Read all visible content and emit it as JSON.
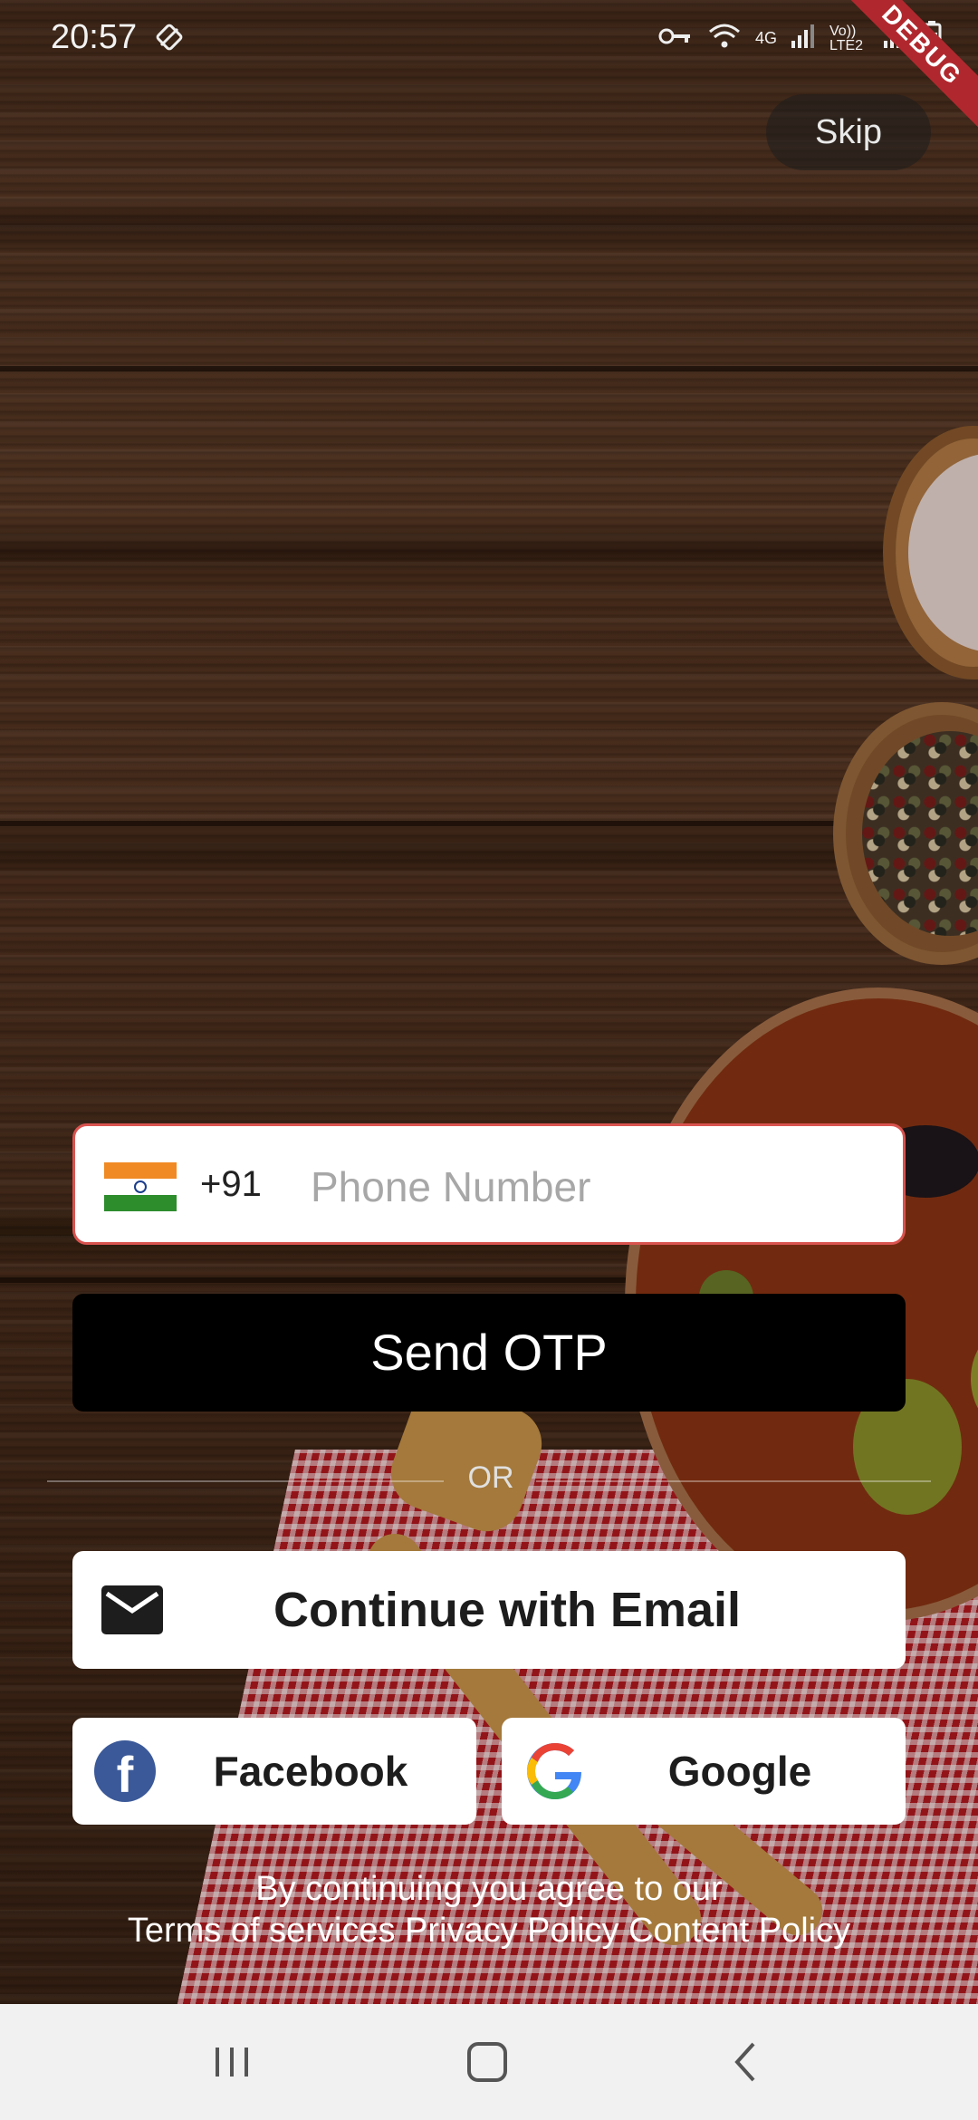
{
  "status_bar": {
    "time": "20:57",
    "network_4g": "4G",
    "network_lte": "Vo)) LTE2",
    "debug_banner": "DEBUG"
  },
  "skip": {
    "label": "Skip"
  },
  "phone_field": {
    "country_code": "+91",
    "placeholder": "Phone Number",
    "value": "",
    "flag": "india-flag-icon"
  },
  "send_otp": {
    "label": "Send OTP"
  },
  "divider": {
    "label": "OR"
  },
  "email_button": {
    "label": "Continue with Email",
    "icon": "envelope-icon"
  },
  "facebook_button": {
    "label": "Facebook",
    "icon": "facebook-icon"
  },
  "google_button": {
    "label": "Google",
    "icon": "google-icon"
  },
  "terms": {
    "line1": "By continuing you agree to our",
    "terms_link": "Terms of services",
    "privacy_link": "Privacy Policy",
    "content_link": "Content Policy"
  },
  "nav": {
    "recents": "recents-icon",
    "home": "home-icon",
    "back": "back-icon"
  },
  "colors": {
    "accent_border": "#d9534f",
    "button_dark": "#000000",
    "facebook": "#3b5998"
  }
}
